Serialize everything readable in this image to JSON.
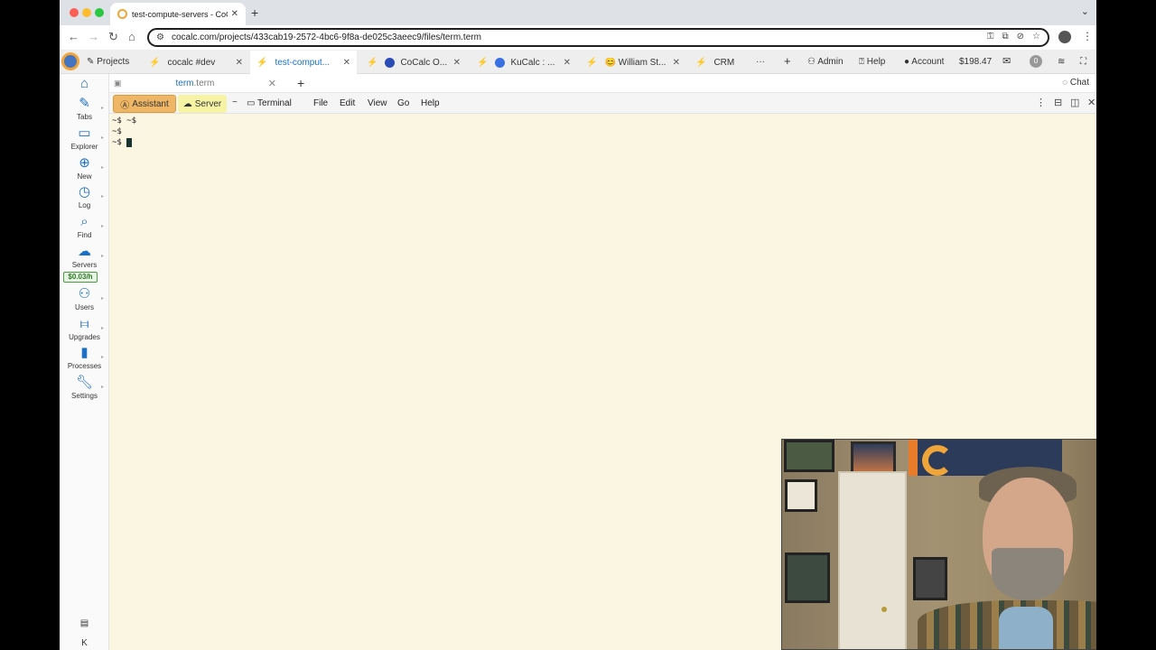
{
  "browser": {
    "tab_title": "test-compute-servers - CoCalc",
    "new_tab": "+",
    "url": "cocalc.com/projects/433cab19-2572-4bc6-9f8a-de025c3aeec9/files/term.term"
  },
  "cocalc": {
    "projects_label": "Projects",
    "project_tabs": [
      {
        "label": "cocalc #dev",
        "icon": "sparkle-icon"
      },
      {
        "label": "test-comput...",
        "icon": "sparkle-icon",
        "active": true
      },
      {
        "label": "CoCalc O...",
        "icon": "globe-icon"
      },
      {
        "label": "KuCalc : ...",
        "icon": "kube-icon"
      },
      {
        "label": "😊 William St...",
        "icon": "sparkle-icon"
      },
      {
        "label": "CRM",
        "icon": "sparkle-icon"
      }
    ],
    "more": "···",
    "add": "+",
    "admin": "Admin",
    "help": "Help",
    "account": "Account",
    "balance": "$198.47",
    "notifications": "0",
    "chat": "Chat"
  },
  "file_tab": {
    "name": "term",
    "ext": ".term"
  },
  "sidebar": {
    "items": [
      {
        "label": "Tabs",
        "icon": "pencil-icon"
      },
      {
        "label": "Explorer",
        "icon": "folder-icon"
      },
      {
        "label": "New",
        "icon": "plus-circle-icon"
      },
      {
        "label": "Log",
        "icon": "history-icon"
      },
      {
        "label": "Find",
        "icon": "search-icon"
      },
      {
        "label": "Servers",
        "icon": "server-icon"
      },
      {
        "label": "Users",
        "icon": "users-icon"
      },
      {
        "label": "Upgrades",
        "icon": "sliders-icon"
      },
      {
        "label": "Processes",
        "icon": "chip-icon"
      },
      {
        "label": "Settings",
        "icon": "wrench-icon"
      }
    ],
    "server_cost": "$0.03/h",
    "bottom_collapse": "K"
  },
  "toolbar": {
    "assistant": "Assistant",
    "server": "Server",
    "tilde": "~",
    "terminal": "Terminal",
    "file": "File",
    "edit": "Edit",
    "view": "View",
    "go": "Go",
    "help": "Help"
  },
  "terminal": {
    "lines": [
      "~$ ~$",
      "~$",
      "~$ "
    ]
  },
  "colors": {
    "accent": "#1b70c8",
    "assistant_bg": "#efb765",
    "server_bg": "#f6f3a5",
    "terminal_bg": "#fbf6e2",
    "cost_green": "#2c7a22"
  }
}
